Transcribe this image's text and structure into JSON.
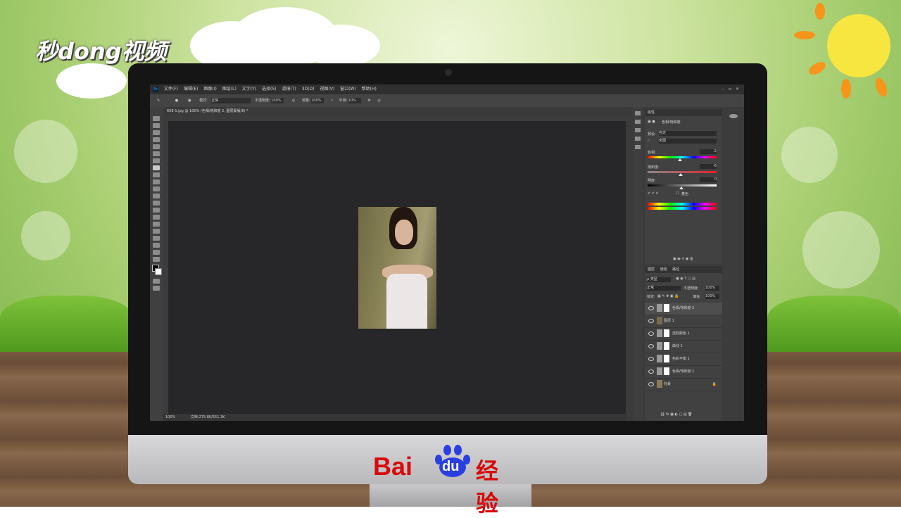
{
  "watermark": {
    "logo_text": "秒dong视频"
  },
  "footer_brand": {
    "bai": "Bai",
    "du": "du",
    "suffix": "经验"
  },
  "ps": {
    "app_icon": "Ps",
    "menu": [
      "文件(F)",
      "编辑(E)",
      "图像(I)",
      "图层(L)",
      "文字(Y)",
      "选择(S)",
      "滤镜(T)",
      "3D(D)",
      "视图(V)",
      "窗口(W)",
      "帮助(H)"
    ],
    "options": {
      "mode_label": "模式:",
      "mode_value": "正常",
      "opacity_label": "不透明度:",
      "opacity_value": "100%",
      "flow_label": "流量:",
      "flow_value": "100%",
      "smooth_label": "平滑:",
      "smooth_value": "10%"
    },
    "doc_tab": "658-1.jpg @ 100% (色相/饱和度 2, 图层蒙版/8) *",
    "status": {
      "zoom": "100%",
      "doc": "文档:275.8K/551.3K"
    },
    "properties": {
      "title": "属性",
      "subtitle": "色相/饱和度",
      "preset_label": "预设:",
      "preset_value": "自定",
      "channel_value": "全图",
      "hue_label": "色相:",
      "hue_value": "-2",
      "sat_label": "饱和度:",
      "sat_value": "-6",
      "light_label": "明度:",
      "light_value": "0",
      "colorize_label": "着色"
    },
    "layers": {
      "tabs": [
        "图层",
        "通道",
        "路径"
      ],
      "kind_label": "ρ 类型",
      "blend": "正常",
      "opacity_label": "不透明度:",
      "opacity_value": "100%",
      "lock_label": "锁定:",
      "fill_label": "填充:",
      "fill_value": "100%",
      "items": [
        {
          "name": "色相/饱和度 2",
          "selected": true
        },
        {
          "name": "图层 1",
          "selected": false
        },
        {
          "name": "选取颜色 1",
          "selected": false
        },
        {
          "name": "曲线 1",
          "selected": false
        },
        {
          "name": "色彩平衡 1",
          "selected": false
        },
        {
          "name": "色相/饱和度 1",
          "selected": false
        },
        {
          "name": "背景",
          "selected": false
        }
      ]
    }
  }
}
